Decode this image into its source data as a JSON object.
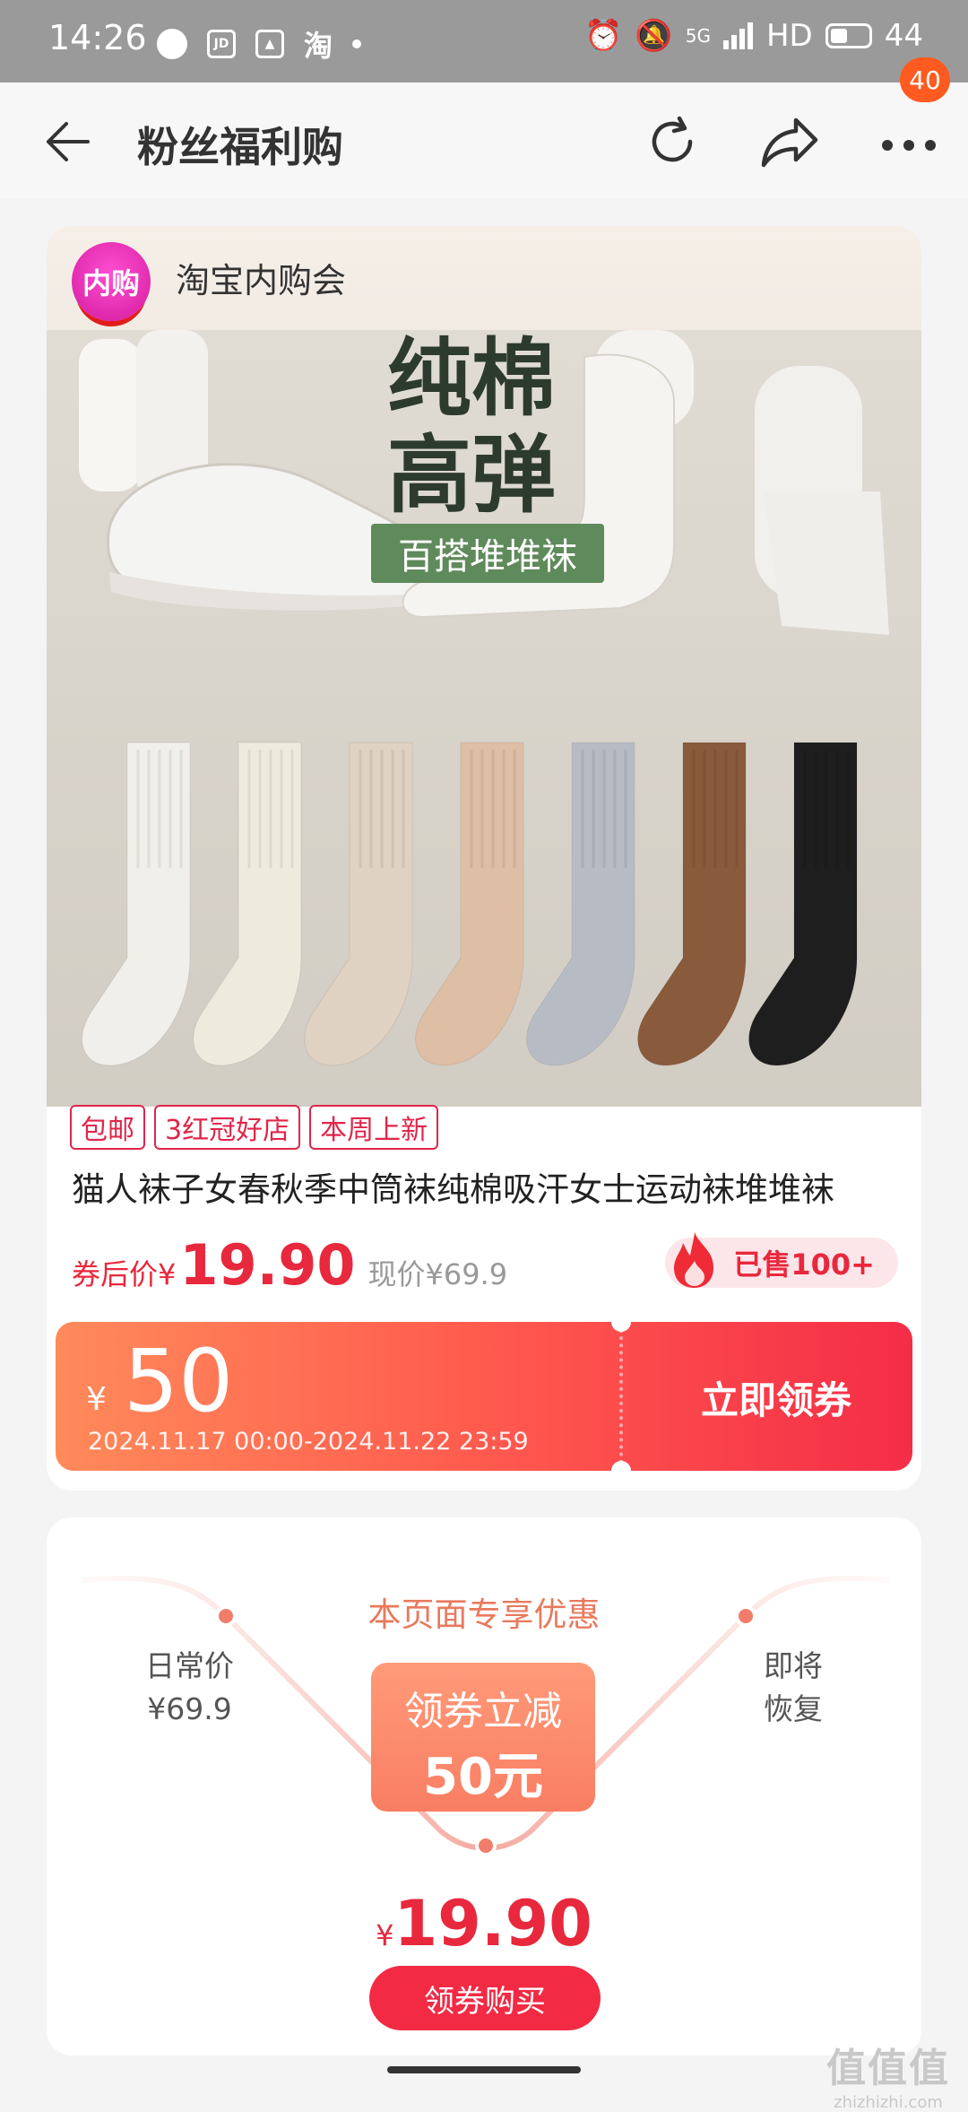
{
  "status_bar": {
    "time": "14:26",
    "app_icons": [
      "JD",
      "淘"
    ],
    "network": "5G",
    "hd": "HD",
    "battery": "44"
  },
  "header": {
    "title": "粉丝福利购",
    "badge_count": "40"
  },
  "shop": {
    "logo_text": "内购",
    "name": "淘宝内购会"
  },
  "product_image": {
    "headline_line1": "纯棉",
    "headline_line2": "高弹",
    "tagline": "百搭堆堆袜",
    "sock_colors": [
      "#f1efea",
      "#eeeade",
      "#e0d2c2",
      "#dfbea6",
      "#b7bcc4",
      "#8a5a3c",
      "#1e1e1e"
    ]
  },
  "product": {
    "tags": [
      "包邮",
      "3红冠好店",
      "本周上新"
    ],
    "title": "猫人袜子女春秋季中筒袜纯棉吸汗女士运动袜堆堆袜",
    "after_coupon_label": "券后价",
    "currency": "¥",
    "after_coupon_price": "19.90",
    "current_price_label": "现价",
    "current_price": "¥69.9",
    "sold": "已售100+"
  },
  "coupon": {
    "currency": "¥",
    "amount": "50",
    "period": "2024.11.17 00:00-2024.11.22 23:59",
    "claim_label": "立即领券"
  },
  "promo": {
    "exclusive": "本页面专享优惠",
    "daily_label": "日常价",
    "daily_price": "¥69.9",
    "restore_line1": "即将",
    "restore_line2": "恢复",
    "center_line1": "领券立减",
    "center_line2": "50元",
    "currency": "¥",
    "final_price": "19.90",
    "buy_label": "领券购买"
  },
  "watermark": {
    "line1": "值值值",
    "line2": "zhizhizhi.com"
  },
  "colors": {
    "accent_red": "#e8283c",
    "coupon_orange": "#ff8a5a",
    "badge_orange": "#ff5a1f"
  }
}
